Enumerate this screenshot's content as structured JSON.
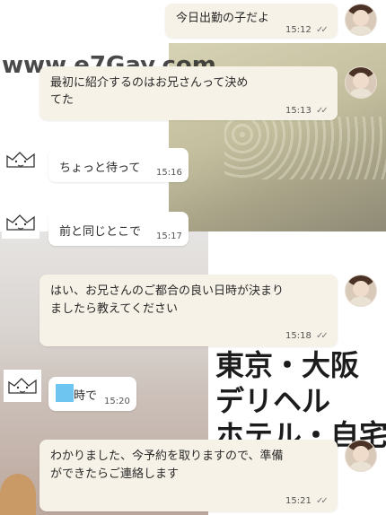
{
  "background": {
    "watermark": "www.e7Gay.com",
    "ad_text": [
      "東京・大阪",
      "デリヘル",
      "ホテル・自宅"
    ]
  },
  "messages": [
    {
      "side": "out",
      "text": "今日出勤の子だよ",
      "time": "15:12",
      "read_icon": "double-check-icon"
    },
    {
      "side": "out",
      "text_lines": [
        "最初に紹介するのはお兄さんって決め",
        "てた"
      ],
      "time": "15:13",
      "read_icon": "double-check-icon"
    },
    {
      "side": "in",
      "text": "ちょっと待って",
      "time": "15:16"
    },
    {
      "side": "in",
      "text": "前と同じとこで",
      "time": "15:17"
    },
    {
      "side": "out",
      "text_lines": [
        "はい、お兄さんのご都合の良い日時が決まり",
        "ましたら教えてください"
      ],
      "time": "15:18",
      "read_icon": "double-check-icon"
    },
    {
      "side": "in",
      "text": "時で",
      "time": "15:20",
      "redacted": true
    },
    {
      "side": "out",
      "text_lines": [
        "わかりました、今予約を取りますので、準備",
        "ができたらご連絡します"
      ],
      "time": "15:21",
      "read_icon": "double-check-icon"
    }
  ],
  "colors": {
    "outgoing_bubble": "#f7f2e7",
    "incoming_bubble": "#ffffff",
    "redaction": "#6ec6f0"
  }
}
